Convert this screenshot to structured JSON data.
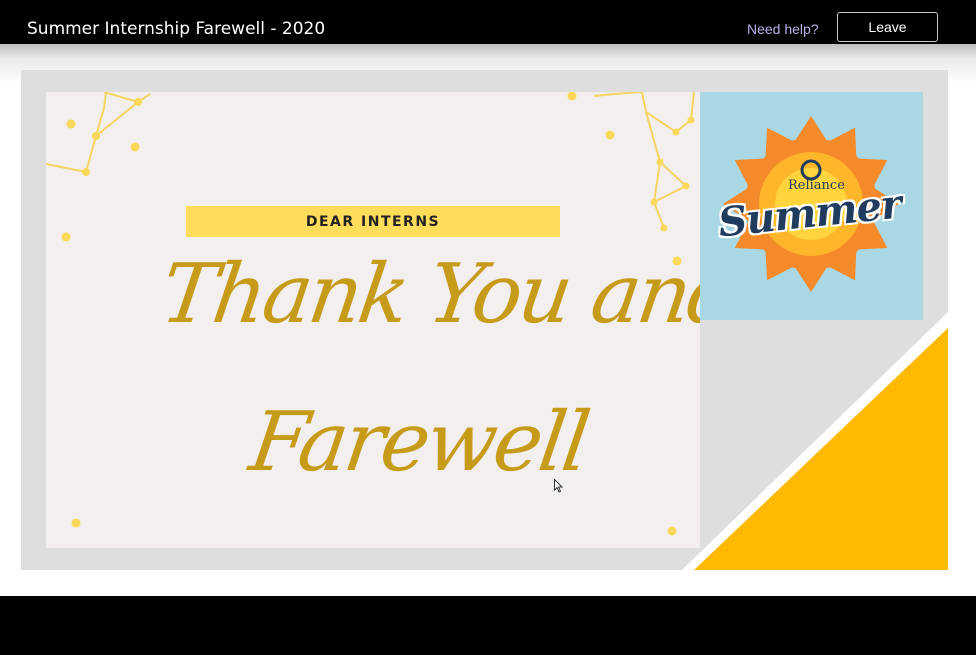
{
  "header": {
    "meeting_title": "Summer Internship Farewell - 2020",
    "help_label": "Need help?",
    "leave_label": "Leave"
  },
  "slide": {
    "banner_text": "DEAR INTERNS",
    "headline_line1": "Thank You and",
    "headline_line2": "Farewell",
    "logo_brand": "Reliance",
    "logo_word": "Summer"
  },
  "colors": {
    "accent_yellow": "#ffb900",
    "banner_yellow": "#ffdc59",
    "script_gold": "#c79b1a",
    "logo_blue": "#a9d8e4",
    "sun_orange": "#f58a2b"
  },
  "icons": {
    "cursor": "mouse-pointer-icon"
  }
}
